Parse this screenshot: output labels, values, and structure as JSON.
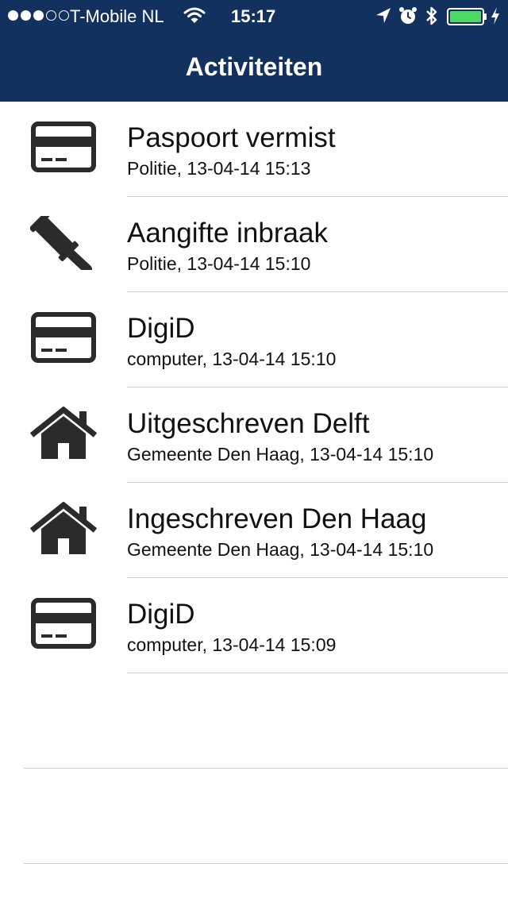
{
  "status_bar": {
    "signal": {
      "filled": 3,
      "total": 5
    },
    "carrier": "T-Mobile NL",
    "time": "15:17"
  },
  "nav": {
    "title": "Activiteiten"
  },
  "activities": [
    {
      "icon": "id-card-icon",
      "title": "Paspoort vermist",
      "subtitle": "Politie, 13-04-14 15:13"
    },
    {
      "icon": "gavel-icon",
      "title": "Aangifte inbraak",
      "subtitle": "Politie, 13-04-14 15:10"
    },
    {
      "icon": "id-card-icon",
      "title": "DigiD",
      "subtitle": "computer, 13-04-14 15:10"
    },
    {
      "icon": "house-icon",
      "title": "Uitgeschreven Delft",
      "subtitle": "Gemeente Den Haag, 13-04-14 15:10"
    },
    {
      "icon": "house-icon",
      "title": "Ingeschreven Den Haag",
      "subtitle": "Gemeente Den Haag, 13-04-14 15:10"
    },
    {
      "icon": "id-card-icon",
      "title": "DigiD",
      "subtitle": "computer, 13-04-14 15:09"
    }
  ],
  "colors": {
    "nav_background": "#13315f",
    "battery_fill": "#4cd964",
    "icon": "#2b2b2b"
  }
}
